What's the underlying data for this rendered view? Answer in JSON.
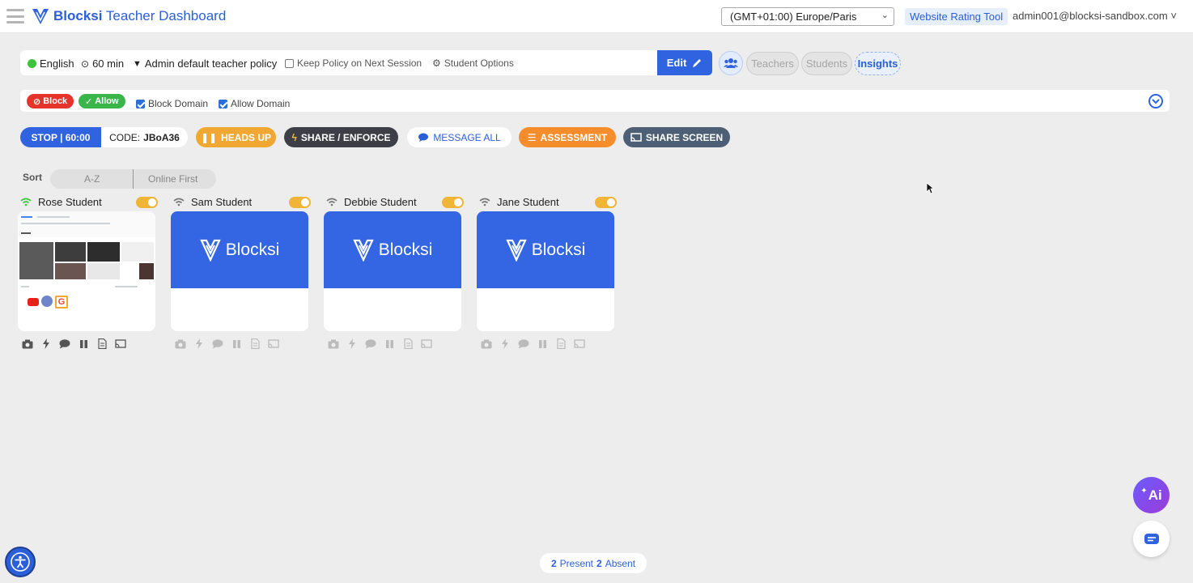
{
  "header": {
    "title_brand": "Blocksi",
    "title_rest": "Teacher Dashboard",
    "timezone": "(GMT+01:00) Europe/Paris",
    "rating_tool": "Website Rating Tool",
    "user": "admin001@blocksi-sandbox.com"
  },
  "policy": {
    "language": "English",
    "duration": "60 min",
    "policy_name": "Admin default teacher policy",
    "keep_policy": "Keep Policy on Next Session",
    "student_options": "Student Options",
    "edit": "Edit"
  },
  "roles": {
    "teachers": "Teachers",
    "students": "Students",
    "insights": "Insights"
  },
  "domains": {
    "block": "Block",
    "allow": "Allow",
    "block_domain": "Block Domain",
    "allow_domain": "Allow Domain"
  },
  "actions": {
    "stop": "STOP | 60:00",
    "code_label": "CODE:",
    "code_value": "JBoA36",
    "heads_up": "HEADS UP",
    "share_enforce": "SHARE / ENFORCE",
    "message_all": "MESSAGE ALL",
    "assessment": "ASSESSMENT",
    "share_screen": "SHARE SCREEN"
  },
  "sort": {
    "label": "Sort",
    "options": [
      "A-Z",
      "Online First"
    ]
  },
  "students": [
    {
      "name": "Rose Student",
      "online": true
    },
    {
      "name": "Sam Student",
      "online": false,
      "thumb_brand": "Blocksi"
    },
    {
      "name": "Debbie Student",
      "online": false,
      "thumb_brand": "Blocksi"
    },
    {
      "name": "Jane Student",
      "online": false,
      "thumb_brand": "Blocksi"
    }
  ],
  "presence": {
    "present_count": "2",
    "present_label": "Present",
    "absent_count": "2",
    "absent_label": "Absent"
  },
  "ai_label": "Ai",
  "colors": {
    "primary": "#2f63e0",
    "heads_up": "#f0a832",
    "share_enforce": "#3e3e46",
    "assessment": "#f58d2d",
    "share_screen": "#4d5f75",
    "block": "#e6342c",
    "allow": "#39b54a",
    "toggle_on": "#f0b537"
  }
}
